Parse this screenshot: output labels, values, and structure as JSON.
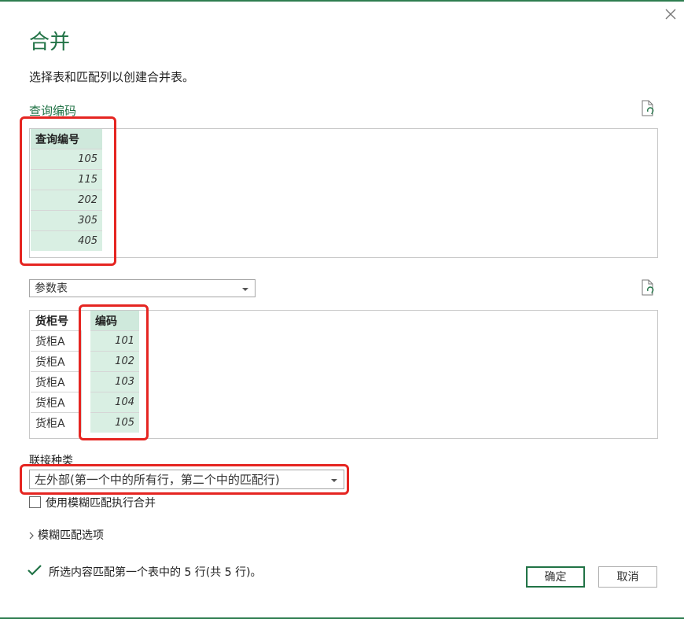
{
  "dialog": {
    "title": "合并",
    "subtitle": "选择表和匹配列以创建合并表。"
  },
  "first_table": {
    "name": "查询编码",
    "column_header": "查询编号",
    "rows": [
      "105",
      "115",
      "202",
      "305",
      "405"
    ]
  },
  "second_table": {
    "selected_query": "参数表",
    "headers": [
      "货柜号",
      "编码"
    ],
    "rows": [
      [
        "货柜A",
        "101"
      ],
      [
        "货柜A",
        "102"
      ],
      [
        "货柜A",
        "103"
      ],
      [
        "货柜A",
        "104"
      ],
      [
        "货柜A",
        "105"
      ]
    ]
  },
  "join": {
    "label": "联接种类",
    "selected": "左外部(第一个中的所有行，第二个中的匹配行)"
  },
  "fuzzy": {
    "checkbox_label": "使用模糊匹配执行合并",
    "options_label": "模糊匹配选项"
  },
  "status": {
    "message": "所选内容匹配第一个表中的 5 行(共 5 行)。"
  },
  "buttons": {
    "ok": "确定",
    "cancel": "取消"
  },
  "icons": {
    "close": "close-icon",
    "refresh": "refresh-document-icon",
    "check": "checkmark-icon",
    "expand": "chevron-right-icon",
    "dropdown": "caret-down-icon"
  },
  "colors": {
    "accent": "#217346",
    "selected_column": "#d9efe3",
    "highlight_box": "#e52521"
  }
}
